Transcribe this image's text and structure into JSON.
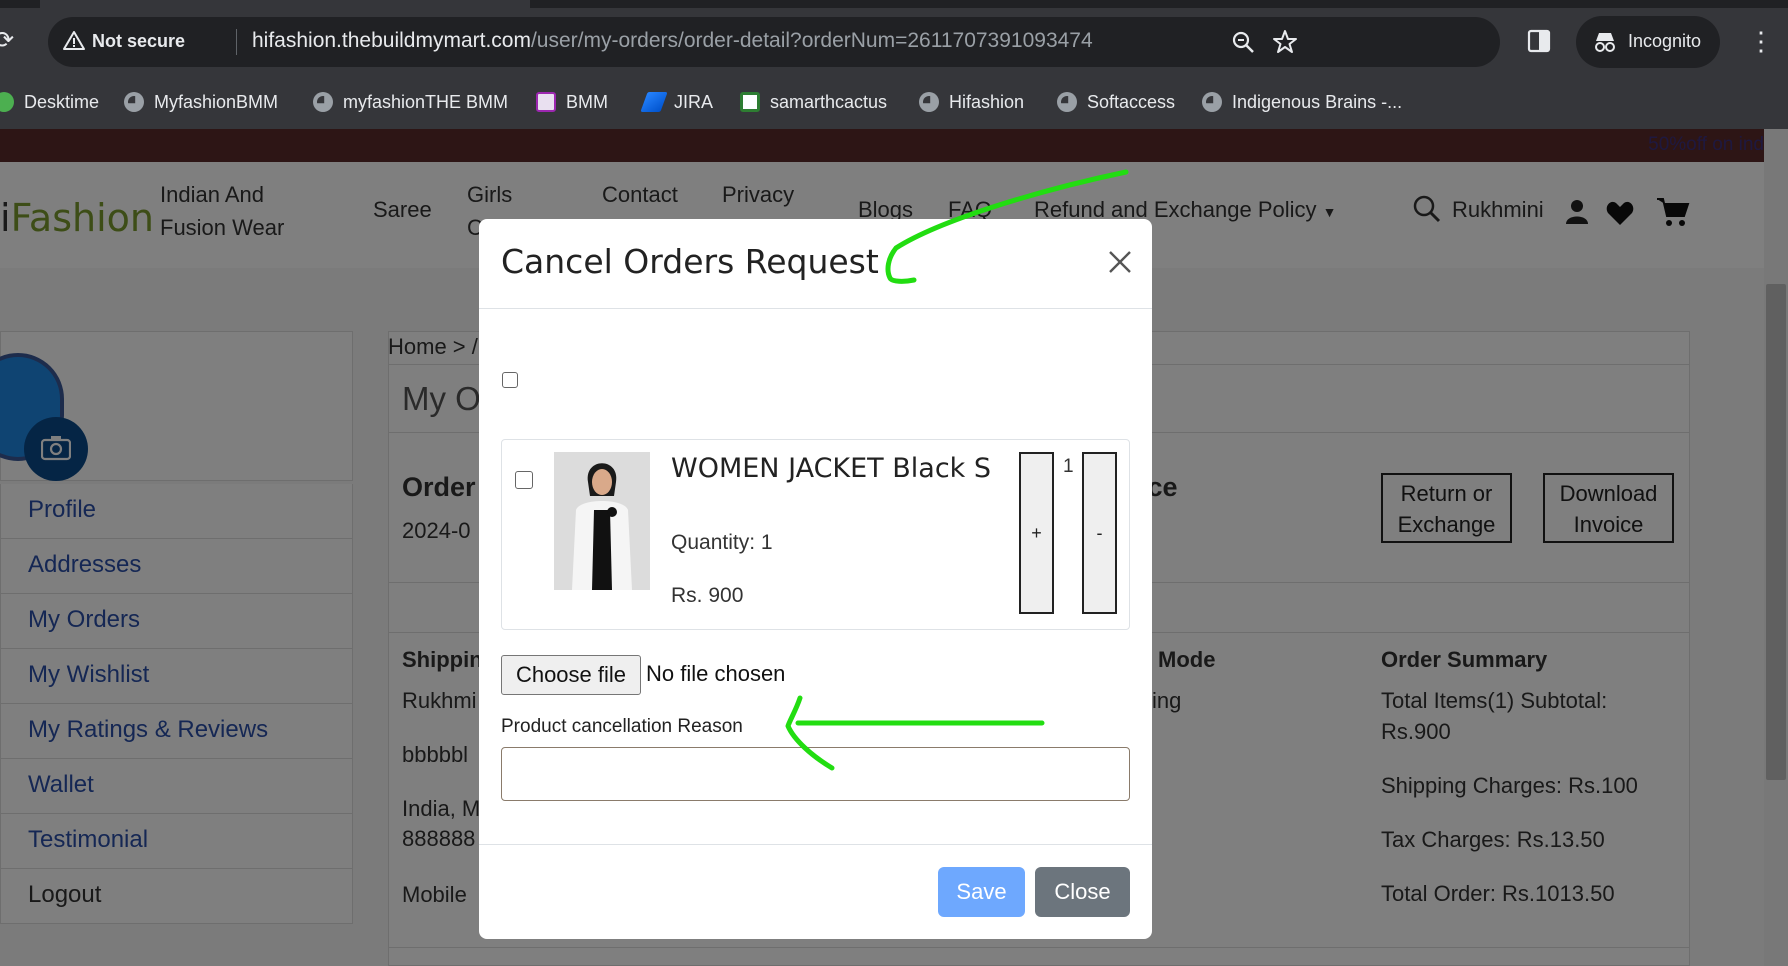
{
  "browser": {
    "security_label": "Not secure",
    "url_host": "hifashion.thebuildmymart.com",
    "url_path": "/user/my-orders/order-detail?orderNum=2611707391093474",
    "incognito_label": "Incognito",
    "bookmarks": [
      "Desktime",
      "MyfashionBMM",
      "myfashionTHE BMM",
      "BMM",
      "JIRA",
      "samarthcactus",
      "Hifashion",
      "Softaccess",
      "Indigenous Brains -..."
    ]
  },
  "site": {
    "promo_text": "50%off on ind",
    "logo_lead": "i",
    "logo_main": "Fashion",
    "nav": {
      "indian": "Indian And",
      "fusion": "Fusion Wear",
      "saree": "Saree",
      "girls": "Girls",
      "girls_cut": "C",
      "contact": "Contact",
      "privacy": "Privacy",
      "blogs": "Blogs",
      "faq": "FAQ",
      "refund": "Refund and Exchange Policy",
      "user": "Rukhmini"
    }
  },
  "sidebar": {
    "items": [
      "Profile",
      "Addresses",
      "My Orders",
      "My Wishlist",
      "My Ratings & Reviews",
      "Wallet",
      "Testimonial",
      "Logout"
    ]
  },
  "page": {
    "breadcrumb": "Home > /",
    "title_partial": "My O",
    "order_label": "Order",
    "order_date_partial": "2024-0",
    "price_partial": "ice",
    "return_btn": [
      "Return or",
      "Exchange"
    ],
    "invoice_btn": [
      "Download",
      "Invoice"
    ],
    "shipping_label": "Shippin",
    "shipping_name": "Rukhmi",
    "shipping_addr": "bbbbbl",
    "shipping_country": "India, M",
    "shipping_phone": "888888",
    "shipping_mobile": "Mobile",
    "mode_label": "Mode",
    "mode_value": "ing",
    "summary": {
      "title": "Order Summary",
      "items_line1": "Total Items(1) Subtotal:",
      "items_line2": "Rs.900",
      "shipping": "Shipping Charges: Rs.100",
      "tax": "Tax Charges: Rs.13.50",
      "total": "Total Order: Rs.1013.50"
    }
  },
  "modal": {
    "title": "Cancel Orders Request",
    "product_name": "WOMEN JACKET Black S",
    "quantity_text": "Quantity: 1",
    "price_text": "Rs. 900",
    "qty_value": "1",
    "plus": "+",
    "minus": "-",
    "choose_file": "Choose file",
    "no_file": "No file chosen",
    "reason_label": "Product cancellation Reason",
    "reason_value": "",
    "save": "Save",
    "close": "Close"
  },
  "colors": {
    "annotation": "#22dd11",
    "save_button": "#6ea8fe",
    "close_button": "#6c757d",
    "sidebar_link": "#2b4fa8",
    "logo_green": "#7a9b2e"
  }
}
